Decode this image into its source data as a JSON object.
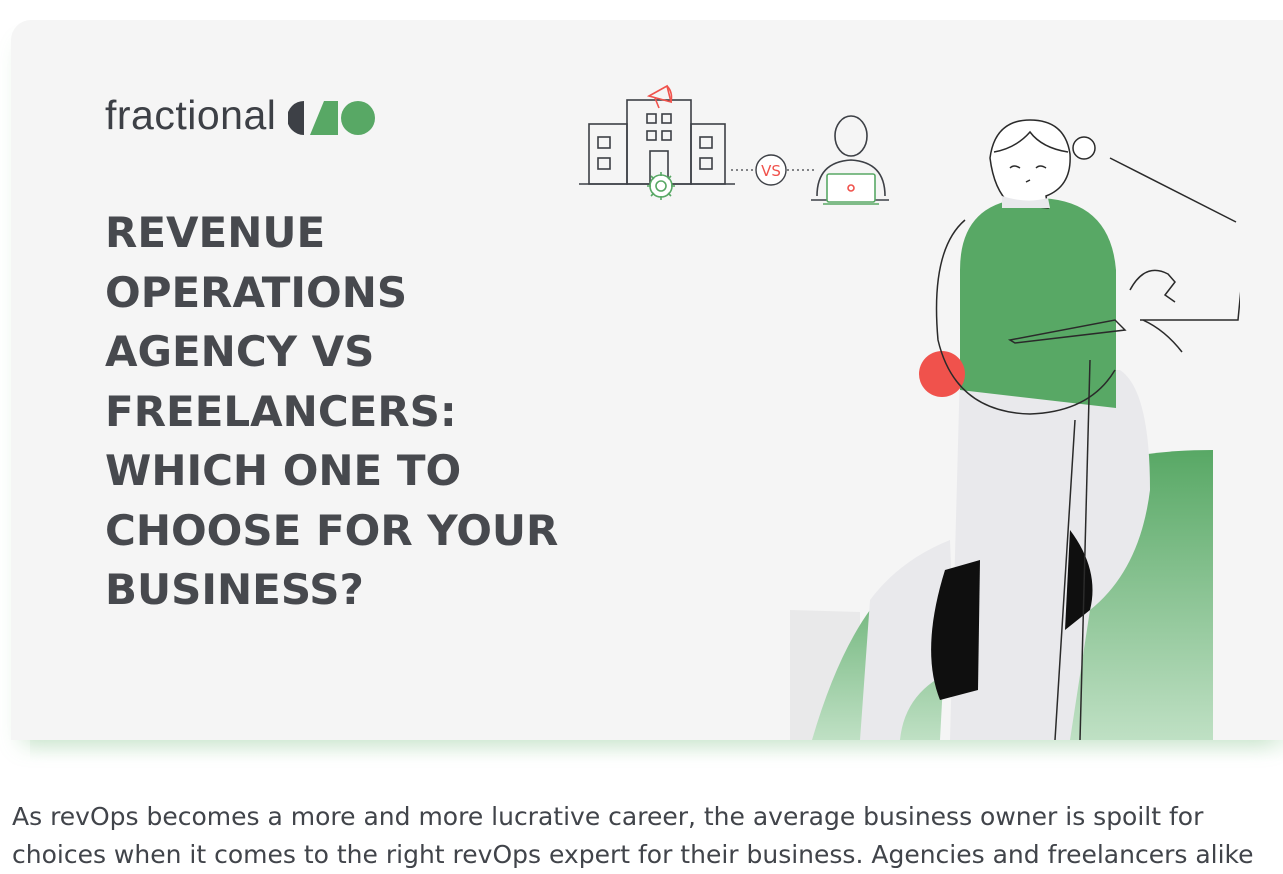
{
  "hero": {
    "logo_text": "fractional",
    "title": "Revenue Operations Agency vs Freelancers: Which One to Choose for Your Business?",
    "vs_badge": "VS",
    "colors": {
      "background": "#f5f5f5",
      "accent_green": "#58a865",
      "accent_red": "#f0524c",
      "title": "#47494e"
    }
  },
  "article": {
    "intro_line_1": "As revOps becomes a more and more lucrative career, the average business owner is spoilt for",
    "intro_line_2": "choices when it comes to the right revOps expert for their business. Agencies and freelancers alike"
  }
}
